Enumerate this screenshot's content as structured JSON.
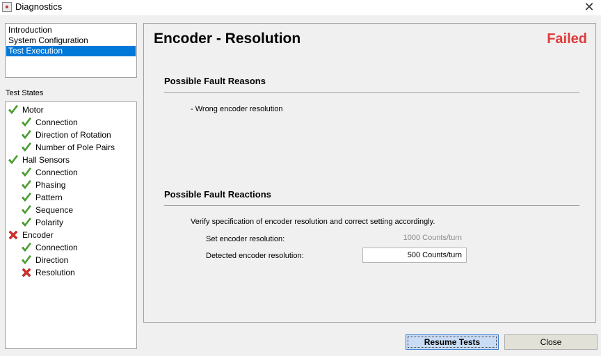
{
  "window": {
    "title": "Diagnostics",
    "close_glyph": "✕"
  },
  "nav": {
    "items": [
      {
        "label": "Introduction",
        "selected": false
      },
      {
        "label": "System Configuration",
        "selected": false
      },
      {
        "label": "Test Execution",
        "selected": true
      }
    ]
  },
  "test_states": {
    "label": "Test States",
    "tree": [
      {
        "label": "Motor",
        "status": "pass",
        "level": 0
      },
      {
        "label": "Connection",
        "status": "pass",
        "level": 1
      },
      {
        "label": "Direction of Rotation",
        "status": "pass",
        "level": 1
      },
      {
        "label": "Number of Pole Pairs",
        "status": "pass",
        "level": 1
      },
      {
        "label": "Hall Sensors",
        "status": "pass",
        "level": 0
      },
      {
        "label": "Connection",
        "status": "pass",
        "level": 1
      },
      {
        "label": "Phasing",
        "status": "pass",
        "level": 1
      },
      {
        "label": "Pattern",
        "status": "pass",
        "level": 1
      },
      {
        "label": "Sequence",
        "status": "pass",
        "level": 1
      },
      {
        "label": "Polarity",
        "status": "pass",
        "level": 1
      },
      {
        "label": "Encoder",
        "status": "fail",
        "level": 0
      },
      {
        "label": "Connection",
        "status": "pass",
        "level": 1
      },
      {
        "label": "Direction",
        "status": "pass",
        "level": 1
      },
      {
        "label": "Resolution",
        "status": "fail",
        "level": 1
      }
    ]
  },
  "panel": {
    "title": "Encoder - Resolution",
    "status": "Failed",
    "status_color": "#e03a3a",
    "fault_reasons": {
      "heading": "Possible Fault Reasons",
      "text": "- Wrong encoder resolution"
    },
    "fault_reactions": {
      "heading": "Possible Fault Reactions",
      "text": "Verify specification of encoder resolution and correct setting accordingly.",
      "set_label": "Set encoder resolution:",
      "set_value": "1000 Counts/turn",
      "detected_label": "Detected encoder resolution:",
      "detected_value": "500 Counts/turn"
    }
  },
  "buttons": {
    "resume": "Resume Tests",
    "close": "Close"
  },
  "icons": {
    "pass": "check-icon",
    "fail": "cross-icon",
    "pass_color": "#4caf2a",
    "fail_color": "#d9302c"
  }
}
